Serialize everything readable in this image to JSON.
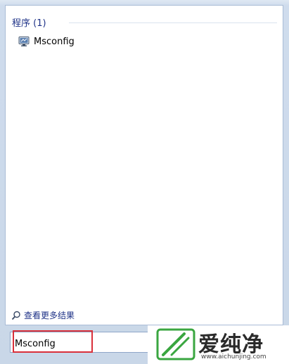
{
  "results": {
    "section_title": "程序 (1)",
    "items": [
      {
        "label": "Msconfig",
        "icon": "msconfig-monitor-icon"
      }
    ],
    "see_more_label": "查看更多结果"
  },
  "search": {
    "value": "Msconfig"
  },
  "watermark": {
    "text": "爱纯净",
    "url": "www.aichunjing.com",
    "logo_icon": "leaf-logo-icon"
  },
  "colors": {
    "section_title": "#1e3287",
    "highlight": "#d9303a",
    "logo_green": "#3aa640"
  }
}
